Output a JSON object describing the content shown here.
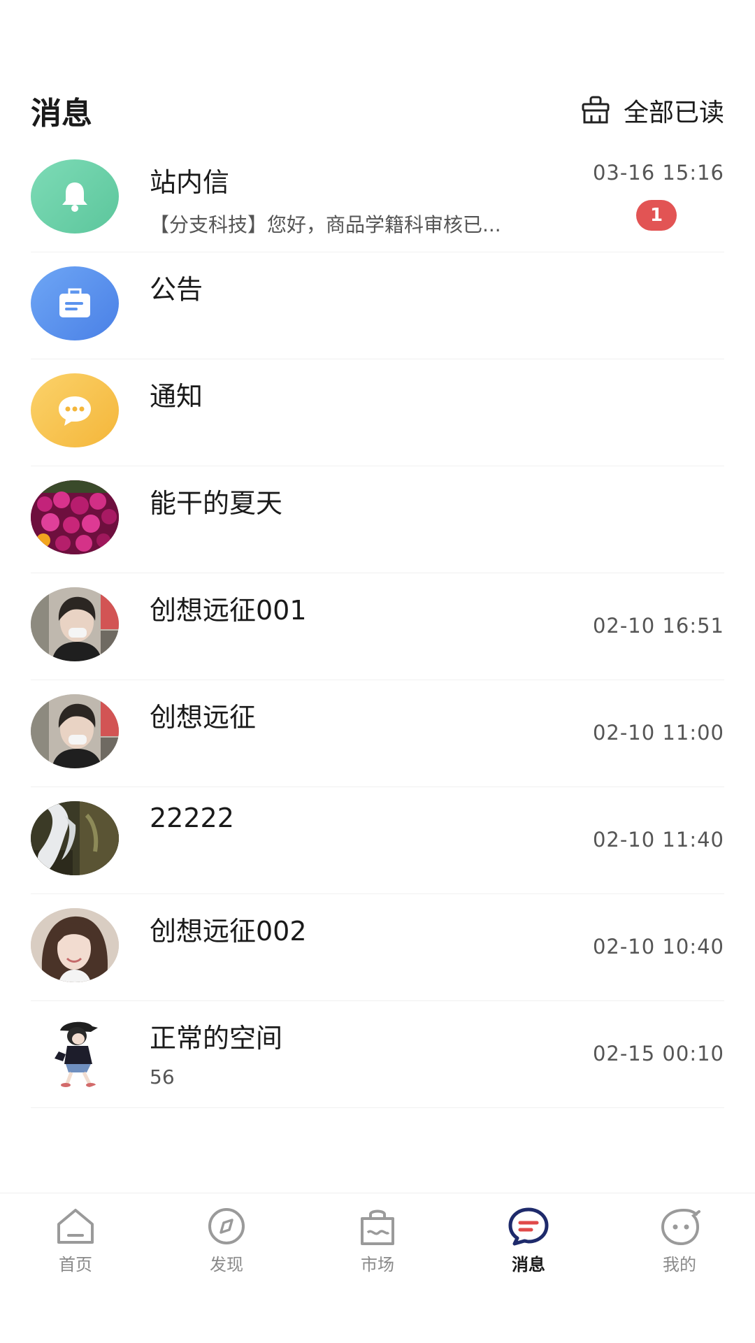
{
  "header": {
    "title": "消息",
    "mark_all_read": "全部已读",
    "mark_all_icon": "broom-icon"
  },
  "conversations": [
    {
      "name": "站内信",
      "time": "03-16 15:16",
      "preview": "【分支科技】您好，商品学籍科审核已...",
      "unread": "1",
      "avatar": "bell-icon"
    },
    {
      "name": "公告",
      "time": "",
      "preview": "",
      "unread": "",
      "avatar": "announcement-icon"
    },
    {
      "name": "通知",
      "time": "",
      "preview": "",
      "unread": "",
      "avatar": "chat-bubble-icon"
    },
    {
      "name": "能干的夏天",
      "time": "",
      "preview": "",
      "unread": "",
      "avatar": "flowers-photo"
    },
    {
      "name": "创想远征001",
      "time": "02-10 16:51",
      "preview": "",
      "unread": "",
      "avatar": "person-photo"
    },
    {
      "name": "创想远征",
      "time": "02-10 11:00",
      "preview": "",
      "unread": "",
      "avatar": "person-photo"
    },
    {
      "name": "22222",
      "time": "02-10 11:40",
      "preview": "",
      "unread": "",
      "avatar": "waterfall-photo"
    },
    {
      "name": "创想远征002",
      "time": "02-10 10:40",
      "preview": "",
      "unread": "",
      "avatar": "girl-photo"
    },
    {
      "name": "正常的空间",
      "time": "02-15 00:10",
      "preview": "56",
      "unread": "",
      "avatar": "cartoon-girl-avatar"
    }
  ],
  "tabbar": [
    {
      "label": "首页",
      "icon": "home-icon",
      "active": false
    },
    {
      "label": "发现",
      "icon": "compass-icon",
      "active": false
    },
    {
      "label": "市场",
      "icon": "shopping-bag-icon",
      "active": false
    },
    {
      "label": "消息",
      "icon": "message-icon",
      "active": true
    },
    {
      "label": "我的",
      "icon": "smiley-icon",
      "active": false
    }
  ],
  "colors": {
    "badge": "#e25454",
    "bell_avatar": "#6fd3a8",
    "announcement_avatar": "#5b93ee",
    "notice_avatar": "#f7c14a",
    "active_tab": "#1e2a6b",
    "active_tab_accent": "#e04a4a"
  }
}
